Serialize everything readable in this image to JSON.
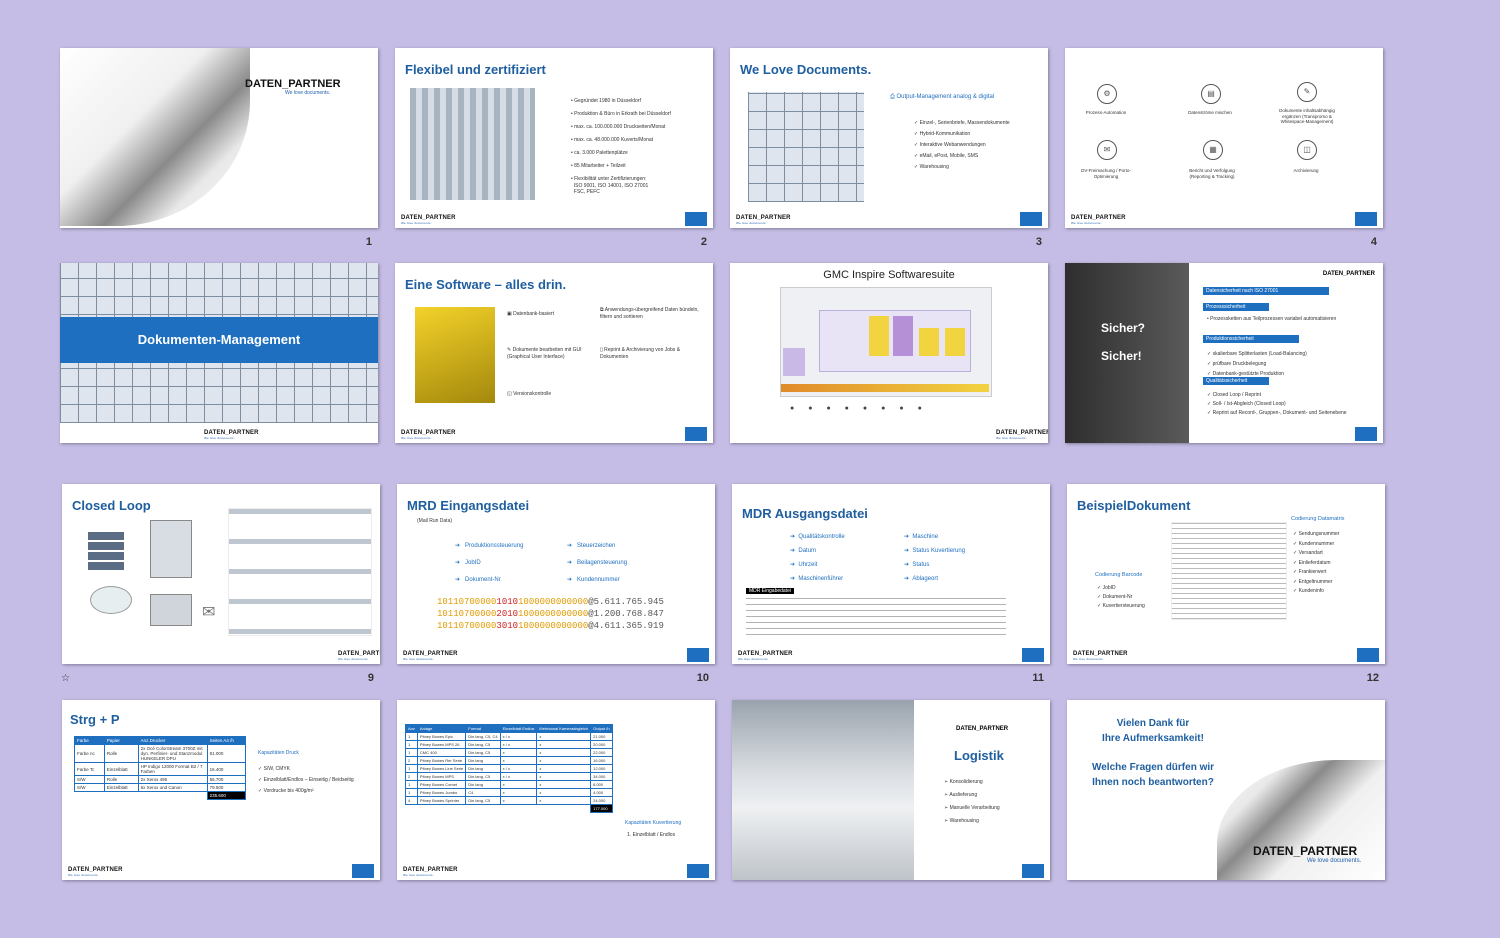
{
  "logo": {
    "name": "DATEN_PARTNER",
    "tagline": "We love documents."
  },
  "slides": [
    {
      "num": "1"
    },
    {
      "num": "2",
      "title": "Flexibel und zertifiziert",
      "bullets": [
        "Gegründet 1980 in Düsseldorf",
        "Produktion & Büro in Erkrath bei Düsseldorf",
        "max. ca. 100.000.000 Druckseiten/Monat",
        "max. ca. 48.000.000 Kuverts/Monat",
        "ca. 3.000 Palettenplätze",
        "85 Mitarbeiter + Teilzeit",
        "Flexibilität unter Zertifizierungen:",
        "ISO 9001, ISO 14001, ISO 27001",
        "FSC, PEFC"
      ]
    },
    {
      "num": "3",
      "title": "We Love Documents.",
      "heading": "Output-Management analog & digital",
      "bullets": [
        "Einzel-, Serienbriefe, Massendokumente",
        "Hybrid-Kommunikation",
        "Interaktive Webanwendungen",
        "eMail, ePost, Mobile, SMS",
        "Warehousing"
      ]
    },
    {
      "num": "4",
      "icons": [
        "Prozess-Automation",
        "Datenströme mischen",
        "Dokumente inhaltsabhängig ergänzen (Transpromo & Whitespace-Management)",
        "DV-Freimachung / Porto-Optimierung",
        "Bericht und Verfolgung (Reporting & Tracking)",
        "Archivierung"
      ]
    },
    {
      "num": "",
      "banner": "Dokumenten-Management"
    },
    {
      "num": "",
      "title": "Eine Software – alles drin.",
      "items": [
        "Datenbank-basiert",
        "Anwendungs-übergreifend Daten bündeln, filtern und sortieren",
        "Dokumente bearbeiten mit GUI (Graphical User Interface)",
        "Reprint & Archivierung von Jobs & Dokumenten",
        "Versionskontrolle"
      ]
    },
    {
      "num": "",
      "title": "GMC Inspire Softwaresuite"
    },
    {
      "num": "",
      "left1": "Sicher?",
      "left2": "Sicher!",
      "heads": [
        "Datensicherheit nach ISO 27001",
        "Prozesssicherheit",
        "Produktionssicherheit",
        "Qualitätssicherheit"
      ],
      "bullets": [
        "Prozessketten aus Teilprozessen variabel automatisieren",
        "skalierbare Splitterlasten (Load-Balancing)",
        "prüfbare Druckbelegung",
        "Datenbank-gestützte Produktion",
        "Closed Loop / Reprint",
        "Soll- / Ist-Abgleich (Closed Loop)",
        "Reprint auf Record-, Gruppen-, Dokument- und Seitenebene"
      ]
    },
    {
      "num": "9",
      "title": "Closed Loop"
    },
    {
      "num": "10",
      "title": "MRD Eingangsdatei",
      "subtitle": "(Mail Run Data)",
      "left": [
        "Produktionssteuerung",
        "JobID",
        "Dokument-Nr"
      ],
      "right": [
        "Steuerzeichen",
        "Beilagensteuerung",
        "Kundennummer"
      ],
      "rows": [
        {
          "a": "10110700000",
          "b": "1010",
          "c": "1000000000000",
          "d": "@5.611.765.945"
        },
        {
          "a": "10110700000",
          "b": "2010",
          "c": "1000000000000",
          "d": "@1.200.768.847"
        },
        {
          "a": "10110700000",
          "b": "3010",
          "c": "1000000000000",
          "d": "@4.611.365.919"
        }
      ]
    },
    {
      "num": "11",
      "title": "MDR Ausgangsdatei",
      "left": [
        "Qualitätskontrolle",
        "Datum",
        "Uhrzeit",
        "Maschinenführer"
      ],
      "right": [
        "Maschine",
        "Status Kuvertierung",
        "Status",
        "Ablageort"
      ],
      "label": "MDR Eingabedatei"
    },
    {
      "num": "12",
      "title": "BeispielDokument",
      "left_head": "Codierung Barcode",
      "left": [
        "JobID",
        "Dokument-Nr",
        "Kuvertiersteuerung"
      ],
      "right_head": "Codierung Datamatrix",
      "right": [
        "Sendungsnummer",
        "Kundennummer",
        "Versandart",
        "Einlieferdatum",
        "Frankierwert",
        "Entgeltnummer",
        "Kundeninfo"
      ]
    },
    {
      "num": "",
      "title": "Strg + P",
      "table_head": [
        "Farbe",
        "Papier",
        "Anz.Drucker",
        "Seiten A4 /h"
      ],
      "table_rows": [
        [
          "Farbe nc",
          "Rolle",
          "2x Océ ColorStream 3700Z mit dyn. Perfinier- und Stanzmodul HUNKELER DPU",
          "81.000"
        ],
        [
          "Farbe Tc",
          "Einzelblatt",
          "HP Indigo 12000 Format B2 / 7 Farben",
          "16.400"
        ],
        [
          "S/W",
          "Rolle",
          "2x Xerox 495",
          "56.700"
        ],
        [
          "S/W",
          "Einzelblatt",
          "6x Xerox und Canon",
          "79.500"
        ]
      ],
      "total": "235.600",
      "cap_head": "Kapazitäten Druck",
      "caps": [
        "S/W, CMYK",
        "Einzelblatt/Endlos – Einseitig / Beidseitig",
        "Vordrucke bis 400g/m²"
      ]
    },
    {
      "num": "",
      "table_head": [
        "Anz",
        "Anlage",
        "Format",
        "Einzelblatt Endlos",
        "Mehrkanal Kameraabgleich",
        "Output /h"
      ],
      "table_rows": [
        [
          "1",
          "Pitney Bowes Epic",
          "Din lang, C5, C4",
          "x / x",
          "x",
          "21.000"
        ],
        [
          "1",
          "Pitney Bowes MPS 26",
          "Din lang, C5",
          "x / x",
          "x",
          "20.000"
        ],
        [
          "1",
          "CMC 400",
          "Din lang, C5",
          "x",
          "x",
          "22.000"
        ],
        [
          "2",
          "Pitney Bowes Rer Serie",
          "Din lang",
          "x",
          "x",
          "16.000"
        ],
        [
          "1",
          "Pitney Bowes Line Serie",
          "Din lang",
          "x / x",
          "x",
          "12.000"
        ],
        [
          "2",
          "Pitney Bowes MPS",
          "Din lang, C5",
          "x / x",
          "x",
          "34.000"
        ],
        [
          "1",
          "Pitney Bowes Comet",
          "Din lang",
          "x",
          "x",
          "8.000"
        ],
        [
          "1",
          "Pitney Bowes Jumbo",
          "C4",
          "x",
          "x",
          "4.000"
        ],
        [
          "4",
          "Pitney Bowes Sprinter",
          "Din lang, C5",
          "x",
          "x",
          "24.000"
        ]
      ],
      "total": "177.000",
      "cap_head": "Kapazitäten Kuvertierung",
      "caps": [
        "Einzelblatt / Endlos"
      ]
    },
    {
      "num": "",
      "title": "Logistik",
      "bullets": [
        "Konsolidierung",
        "Auslieferung",
        "Manuelle Verarbeitung",
        "Warehousing"
      ]
    },
    {
      "num": "",
      "thanks1": "Vielen Dank für",
      "thanks2": "Ihre Aufmerksamkeit!",
      "q1": "Welche Fragen dürfen wir",
      "q2": "Ihnen noch beantworten?"
    }
  ]
}
